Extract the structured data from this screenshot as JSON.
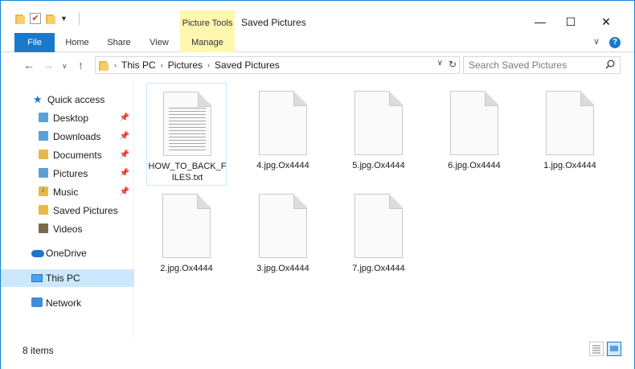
{
  "window": {
    "title": "Saved Pictures",
    "contextual_tab_group": "Picture Tools",
    "controls": {
      "minimize": "—",
      "maximize": "☐",
      "close": "✕"
    }
  },
  "ribbon": {
    "tabs": [
      {
        "label": "File"
      },
      {
        "label": "Home"
      },
      {
        "label": "Share"
      },
      {
        "label": "View"
      },
      {
        "label": "Manage"
      }
    ]
  },
  "address": {
    "crumbs": [
      "This PC",
      "Pictures",
      "Saved Pictures"
    ],
    "search_placeholder": "Search Saved Pictures"
  },
  "sidebar": {
    "quick_access": "Quick access",
    "items": [
      {
        "label": "Desktop",
        "pinned": true
      },
      {
        "label": "Downloads",
        "pinned": true
      },
      {
        "label": "Documents",
        "pinned": true
      },
      {
        "label": "Pictures",
        "pinned": true
      },
      {
        "label": "Music",
        "pinned": true
      },
      {
        "label": "Saved Pictures",
        "pinned": false
      },
      {
        "label": "Videos",
        "pinned": false
      }
    ],
    "onedrive": "OneDrive",
    "this_pc": "This PC",
    "network": "Network"
  },
  "files": [
    {
      "name": "HOW_TO_BACK_FILES.txt",
      "type": "text"
    },
    {
      "name": "4.jpg.Ox4444",
      "type": "blank"
    },
    {
      "name": "5.jpg.Ox4444",
      "type": "blank"
    },
    {
      "name": "6.jpg.Ox4444",
      "type": "blank"
    },
    {
      "name": "1.jpg.Ox4444",
      "type": "blank"
    },
    {
      "name": "2.jpg.Ox4444",
      "type": "blank"
    },
    {
      "name": "3.jpg.Ox4444",
      "type": "blank"
    },
    {
      "name": "7.jpg.Ox4444",
      "type": "blank"
    }
  ],
  "status": {
    "item_count": "8 items"
  },
  "colors": {
    "accent": "#1979ca",
    "selection": "#cce8ff",
    "contextual_tab": "#fdf7b0"
  }
}
